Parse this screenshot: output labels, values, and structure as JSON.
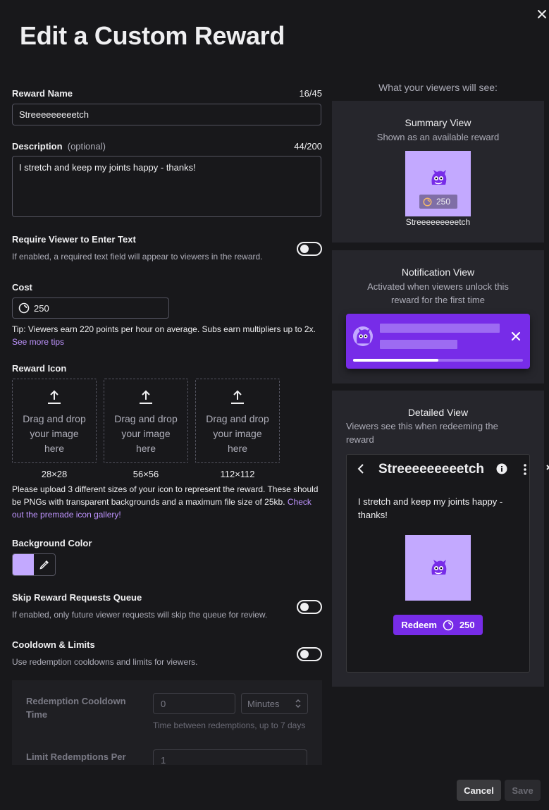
{
  "dialog": {
    "title": "Edit a Custom Reward"
  },
  "reward_name": {
    "label": "Reward Name",
    "counter": "16/45",
    "value": "Streeeeeeeeetch"
  },
  "description": {
    "label": "Description",
    "optional": "(optional)",
    "counter": "44/200",
    "value": "I stretch and keep my joints happy - thanks!"
  },
  "require_text": {
    "label": "Require Viewer to Enter Text",
    "help": "If enabled, a required text field will appear to viewers in the reward.",
    "enabled": false
  },
  "cost": {
    "label": "Cost",
    "value": "250",
    "tip": "Tip: Viewers earn 220 points per hour on average. Subs earn multipliers up to 2x.",
    "tip_link": "See more tips"
  },
  "reward_icon": {
    "label": "Reward Icon",
    "drop_text": "Drag and drop your image here",
    "sizes": [
      "28×28",
      "56×56",
      "112×112"
    ],
    "help": "Please upload 3 different sizes of your icon to represent the reward. These should be PNGs with transparent backgrounds and a maximum file size of 25kb.",
    "help_link": "Check out the premade icon gallery!"
  },
  "background_color": {
    "label": "Background Color",
    "value": "#c3a9ff"
  },
  "skip_queue": {
    "label": "Skip Reward Requests Queue",
    "help": "If enabled, only future viewer requests will skip the queue for review.",
    "enabled": false
  },
  "cooldown": {
    "label": "Cooldown & Limits",
    "help": "Use redemption cooldowns and limits for viewers.",
    "enabled": false,
    "redemption_cooldown_label": "Redemption Cooldown Time",
    "redemption_cooldown_value": "0",
    "unit": "Minutes",
    "cooldown_help": "Time between redemptions, up to 7 days",
    "limit_label": "Limit Redemptions Per",
    "limit_value": "1"
  },
  "preview": {
    "heading": "What your viewers will see:",
    "summary": {
      "title": "Summary View",
      "subtitle": "Shown as an available reward",
      "cost": "250",
      "name": "Streeeeeeeeetch"
    },
    "notification": {
      "title": "Notification View",
      "subtitle": "Activated when viewers unlock this reward for the first time",
      "progress": 0.5
    },
    "detailed": {
      "title": "Detailed View",
      "subtitle": "Viewers see this when redeeming the reward",
      "name": "Streeeeeeeeetch",
      "description": "I stretch and keep my joints happy - thanks!",
      "redeem_label": "Redeem",
      "cost": "250"
    }
  },
  "footer": {
    "cancel": "Cancel",
    "save": "Save"
  },
  "colors": {
    "accent": "#772ce8",
    "tile_bg": "#c3a9ff",
    "link": "#bf94ff"
  }
}
